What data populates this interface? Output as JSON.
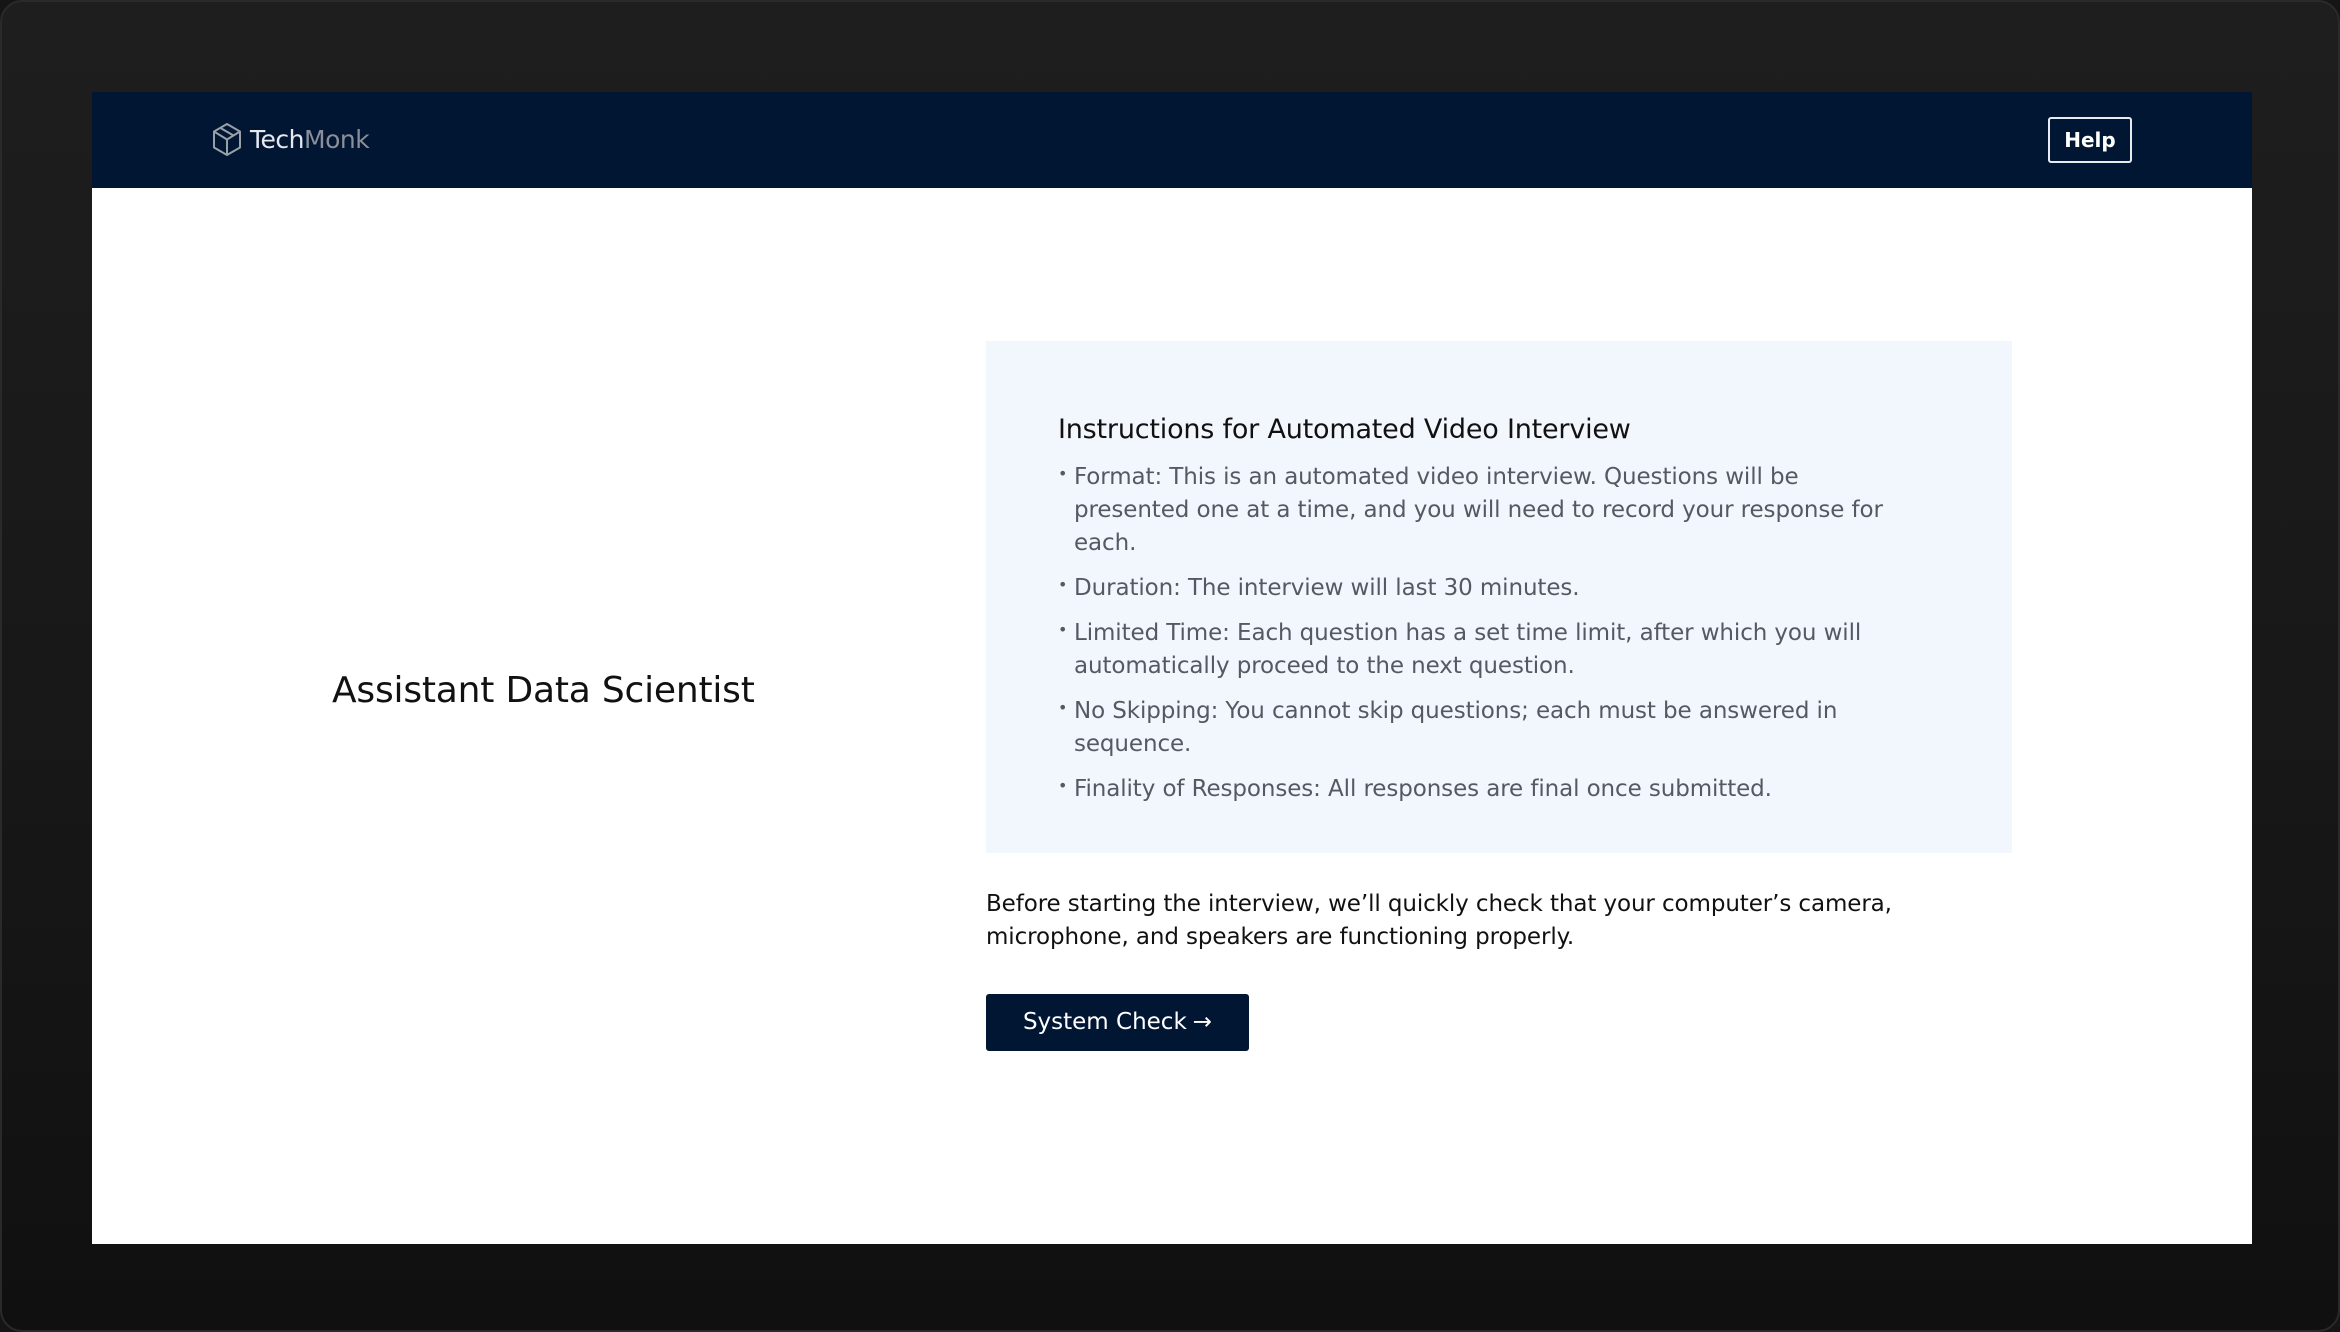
{
  "header": {
    "brand": {
      "first": "Tech",
      "second": "Monk",
      "icon": "cube-logo-icon"
    },
    "help_label": "Help"
  },
  "job": {
    "title": "Assistant Data Scientist"
  },
  "instructions": {
    "heading": "Instructions for Automated Video Interview",
    "items": [
      {
        "text": "Format: This is an automated video interview. Questions will be presented one at a time, and you will need to record your response for each."
      },
      {
        "text": "Duration: The interview will last 30 minutes."
      },
      {
        "text": "Limited Time:  Each question has a set time limit, after which you will automatically proceed to the next question."
      },
      {
        "text": "No Skipping: You cannot skip questions; each must be answered in sequence."
      },
      {
        "text": "Finality of Responses: All responses are final once submitted."
      }
    ]
  },
  "system_check": {
    "note": "Before starting the interview, we’ll quickly check that your computer’s camera, microphone, and speakers are functioning properly.",
    "button_label": "System Check",
    "button_arrow": "→"
  },
  "colors": {
    "navbar": "#001633",
    "panel": "#f2f6fd",
    "button": "#001633",
    "body_text": "#111111",
    "muted_text": "#555a62"
  }
}
